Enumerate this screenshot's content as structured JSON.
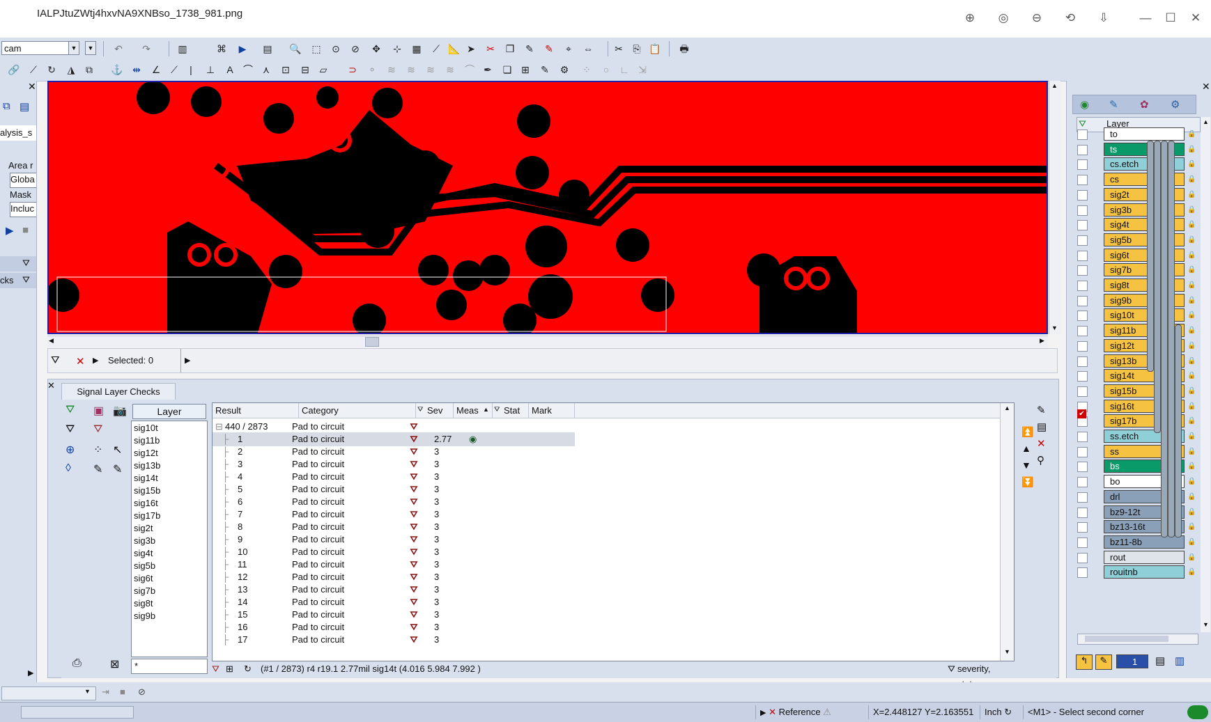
{
  "window": {
    "title": "IALPJtuZWtj4hxvNA9XNBso_1738_981.png"
  },
  "toolbar": {
    "job_combo": "cam"
  },
  "left_panel": {
    "item1": "alysis_s",
    "area_label": "Area r",
    "area_value": "Globa",
    "mask_label": "Mask",
    "mask_value": "Incluc",
    "checks_label": "cks"
  },
  "canvas": {
    "background_color": "#ff0000",
    "copper_color": "#000000"
  },
  "selection_bar": {
    "selected_label": "Selected: 0"
  },
  "results": {
    "tab_label": "Signal Layer Checks",
    "layer_header": "Layer",
    "layers": [
      "sig10t",
      "sig11b",
      "sig12t",
      "sig13b",
      "sig14t",
      "sig15b",
      "sig16t",
      "sig17b",
      "sig2t",
      "sig3b",
      "sig4t",
      "sig5b",
      "sig6t",
      "sig7b",
      "sig8t",
      "sig9b"
    ],
    "filter_value": "*",
    "columns": [
      "Result",
      "Category",
      "Sev",
      "Meas",
      "Stat",
      "Mark"
    ],
    "group_row": {
      "result": "440 / 2873",
      "category": "Pad to circuit"
    },
    "rows": [
      {
        "result": "1",
        "category": "Pad to circuit",
        "meas": "2.77"
      },
      {
        "result": "2",
        "category": "Pad to circuit",
        "meas": "3"
      },
      {
        "result": "3",
        "category": "Pad to circuit",
        "meas": "3"
      },
      {
        "result": "4",
        "category": "Pad to circuit",
        "meas": "3"
      },
      {
        "result": "5",
        "category": "Pad to circuit",
        "meas": "3"
      },
      {
        "result": "6",
        "category": "Pad to circuit",
        "meas": "3"
      },
      {
        "result": "7",
        "category": "Pad to circuit",
        "meas": "3"
      },
      {
        "result": "8",
        "category": "Pad to circuit",
        "meas": "3"
      },
      {
        "result": "9",
        "category": "Pad to circuit",
        "meas": "3"
      },
      {
        "result": "10",
        "category": "Pad to circuit",
        "meas": "3"
      },
      {
        "result": "11",
        "category": "Pad to circuit",
        "meas": "3"
      },
      {
        "result": "12",
        "category": "Pad to circuit",
        "meas": "3"
      },
      {
        "result": "13",
        "category": "Pad to circuit",
        "meas": "3"
      },
      {
        "result": "14",
        "category": "Pad to circuit",
        "meas": "3"
      },
      {
        "result": "15",
        "category": "Pad to circuit",
        "meas": "3"
      },
      {
        "result": "16",
        "category": "Pad to circuit",
        "meas": "3"
      },
      {
        "result": "17",
        "category": "Pad to circuit",
        "meas": "3"
      }
    ],
    "status_text": "(#1 / 2873)   r4 r19.1   2.77mil   sig14t (4.016 5.984 7.992 )",
    "filter_text": "severity, status"
  },
  "layer_panel": {
    "header": "Layer",
    "layers": [
      {
        "name": "to",
        "color": "#ffffff"
      },
      {
        "name": "ts",
        "color": "#0a9a6a"
      },
      {
        "name": "cs.etch",
        "color": "#8fd0d8"
      },
      {
        "name": "cs",
        "color": "#f5c242"
      },
      {
        "name": "sig2t",
        "color": "#f5c242"
      },
      {
        "name": "sig3b",
        "color": "#f5c242"
      },
      {
        "name": "sig4t",
        "color": "#f5c242"
      },
      {
        "name": "sig5b",
        "color": "#f5c242"
      },
      {
        "name": "sig6t",
        "color": "#f5c242"
      },
      {
        "name": "sig7b",
        "color": "#f5c242"
      },
      {
        "name": "sig8t",
        "color": "#f5c242"
      },
      {
        "name": "sig9b",
        "color": "#f5c242"
      },
      {
        "name": "sig10t",
        "color": "#f5c242"
      },
      {
        "name": "sig11b",
        "color": "#f5c242"
      },
      {
        "name": "sig12t",
        "color": "#f5c242"
      },
      {
        "name": "sig13b",
        "color": "#f5c242"
      },
      {
        "name": "sig14t",
        "color": "#f5c242"
      },
      {
        "name": "sig15b",
        "color": "#f5c242"
      },
      {
        "name": "sig16t",
        "color": "#f5c242"
      },
      {
        "name": "sig17b",
        "color": "#f5c242"
      },
      {
        "name": "ss.etch",
        "color": "#8fd0d8"
      },
      {
        "name": "ss",
        "color": "#f5c242"
      },
      {
        "name": "bs",
        "color": "#0a9a6a"
      },
      {
        "name": "bo",
        "color": "#ffffff"
      },
      {
        "name": "drl",
        "color": "#8aa0b8"
      },
      {
        "name": "bz9-12t",
        "color": "#8aa0b8"
      },
      {
        "name": "bz13-16t",
        "color": "#8aa0b8"
      },
      {
        "name": "bz11-8b",
        "color": "#8aa0b8"
      },
      {
        "name": "rout",
        "color": "#dfe3ea"
      },
      {
        "name": "rouitnb",
        "color": "#8fd0d8"
      }
    ],
    "bottom_combo": "1"
  },
  "statusbar": {
    "reference": "Reference",
    "coords": "X=2.448127   Y=2.163551",
    "units": "Inch",
    "hint": "<M1> - Select second corner"
  }
}
